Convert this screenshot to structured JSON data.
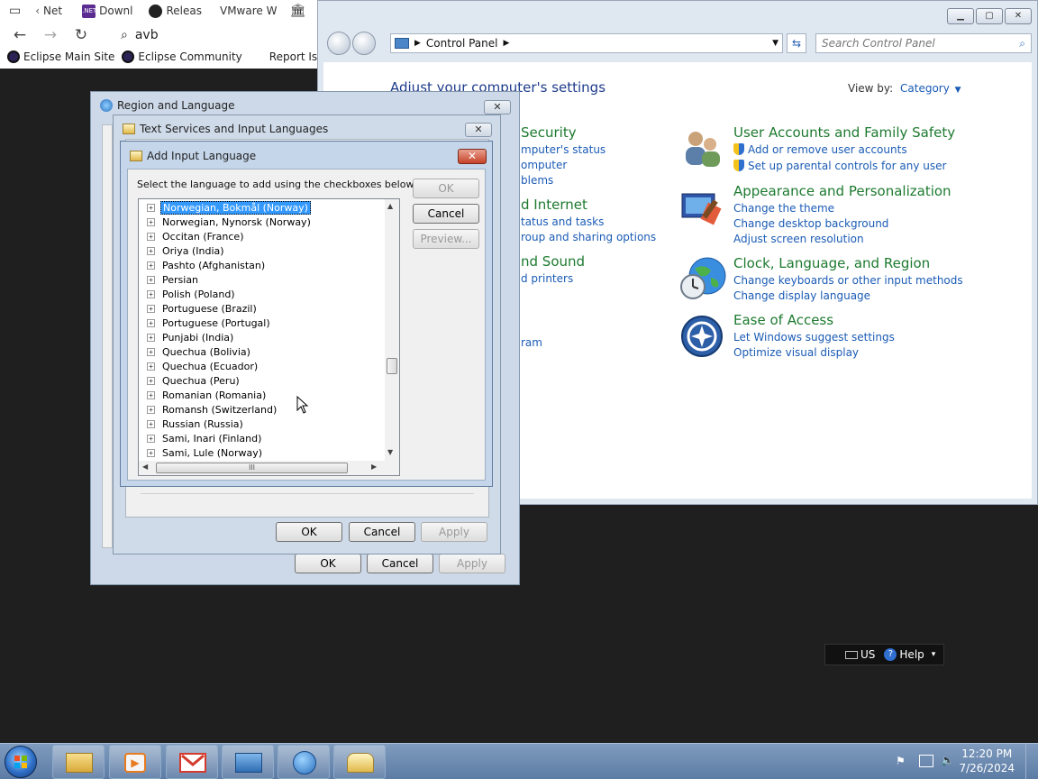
{
  "browser": {
    "tabs": [
      {
        "label": "Net",
        "icon": "back-chevron-icon"
      },
      {
        "label": "Downl",
        "icon": "net-logo-icon"
      },
      {
        "label": "Releas",
        "icon": "github-icon"
      },
      {
        "label": "VMware W",
        "icon": ""
      }
    ],
    "url_text": "avb",
    "bookmarks": [
      "Eclipse Main Site",
      "Eclipse Community",
      "Report Issues"
    ]
  },
  "control_panel": {
    "breadcrumb": "Control Panel",
    "search_placeholder": "Search Control Panel",
    "heading": "Adjust your computer's settings",
    "view_by_label": "View by:",
    "view_by_value": "Category",
    "left_column": {
      "security_title": "Security",
      "security_links": [
        "mputer's status",
        "omputer",
        "blems"
      ],
      "internet_title": "d Internet",
      "internet_links": [
        "tatus and tasks",
        "roup and sharing options"
      ],
      "sound_title": "nd Sound",
      "sound_links": [
        "d printers"
      ],
      "programs_link": "ram"
    },
    "categories": [
      {
        "title": "User Accounts and Family Safety",
        "links": [
          "Add or remove user accounts",
          "Set up parental controls for any user"
        ]
      },
      {
        "title": "Appearance and Personalization",
        "links": [
          "Change the theme",
          "Change desktop background",
          "Adjust screen resolution"
        ]
      },
      {
        "title": "Clock, Language, and Region",
        "links": [
          "Change keyboards or other input methods",
          "Change display language"
        ]
      },
      {
        "title": "Ease of Access",
        "links": [
          "Let Windows suggest settings",
          "Optimize visual display"
        ]
      }
    ]
  },
  "region_language": {
    "title": "Region and Language",
    "ok": "OK",
    "cancel": "Cancel",
    "apply": "Apply"
  },
  "text_services": {
    "title": "Text Services and Input Languages",
    "ok": "OK",
    "cancel": "Cancel",
    "apply": "Apply"
  },
  "add_input_language": {
    "title": "Add Input Language",
    "instruction": "Select the language to add using the checkboxes below.",
    "ok": "OK",
    "cancel": "Cancel",
    "preview": "Preview...",
    "languages": [
      "Norwegian, Bokmål (Norway)",
      "Norwegian, Nynorsk (Norway)",
      "Occitan (France)",
      "Oriya (India)",
      "Pashto (Afghanistan)",
      "Persian",
      "Polish (Poland)",
      "Portuguese (Brazil)",
      "Portuguese (Portugal)",
      "Punjabi (India)",
      "Quechua (Bolivia)",
      "Quechua (Ecuador)",
      "Quechua (Peru)",
      "Romanian (Romania)",
      "Romansh (Switzerland)",
      "Russian (Russia)",
      "Sami, Inari (Finland)",
      "Sami, Lule (Norway)"
    ],
    "selected_index": 0,
    "hscroll_grip": "III"
  },
  "language_bar": {
    "lang": "US",
    "help": "Help"
  },
  "taskbar": {
    "time": "12:20 PM",
    "date": "7/26/2024",
    "apps": [
      "explorer-icon",
      "media-player-icon",
      "gmail-icon",
      "control-panel-icon",
      "region-clock-icon",
      "keyboard-settings-icon"
    ]
  }
}
